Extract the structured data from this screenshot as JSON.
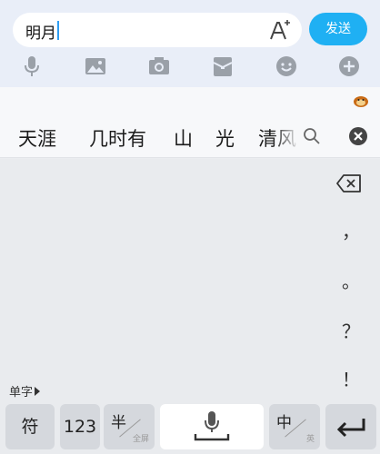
{
  "chat": {
    "input_value": "明月",
    "send_label": "发送"
  },
  "toolbar_icons": [
    "microphone-icon",
    "image-icon",
    "camera-icon",
    "red-envelope-icon",
    "emoji-icon",
    "plus-icon"
  ],
  "candidates": [
    "天涯",
    "几时有",
    "山",
    "光",
    "清风"
  ],
  "keyboard": {
    "side_keys": [
      "，",
      "。",
      "？",
      "！"
    ],
    "single_char_label": "单字",
    "symbols_label": "符",
    "numbers_label": "123",
    "half_label": "半",
    "full_label": "全屏",
    "zh_label": "中",
    "en_label": "英"
  },
  "colors": {
    "accent": "#1fb0f3",
    "icon_gray": "#9aa0a8"
  }
}
